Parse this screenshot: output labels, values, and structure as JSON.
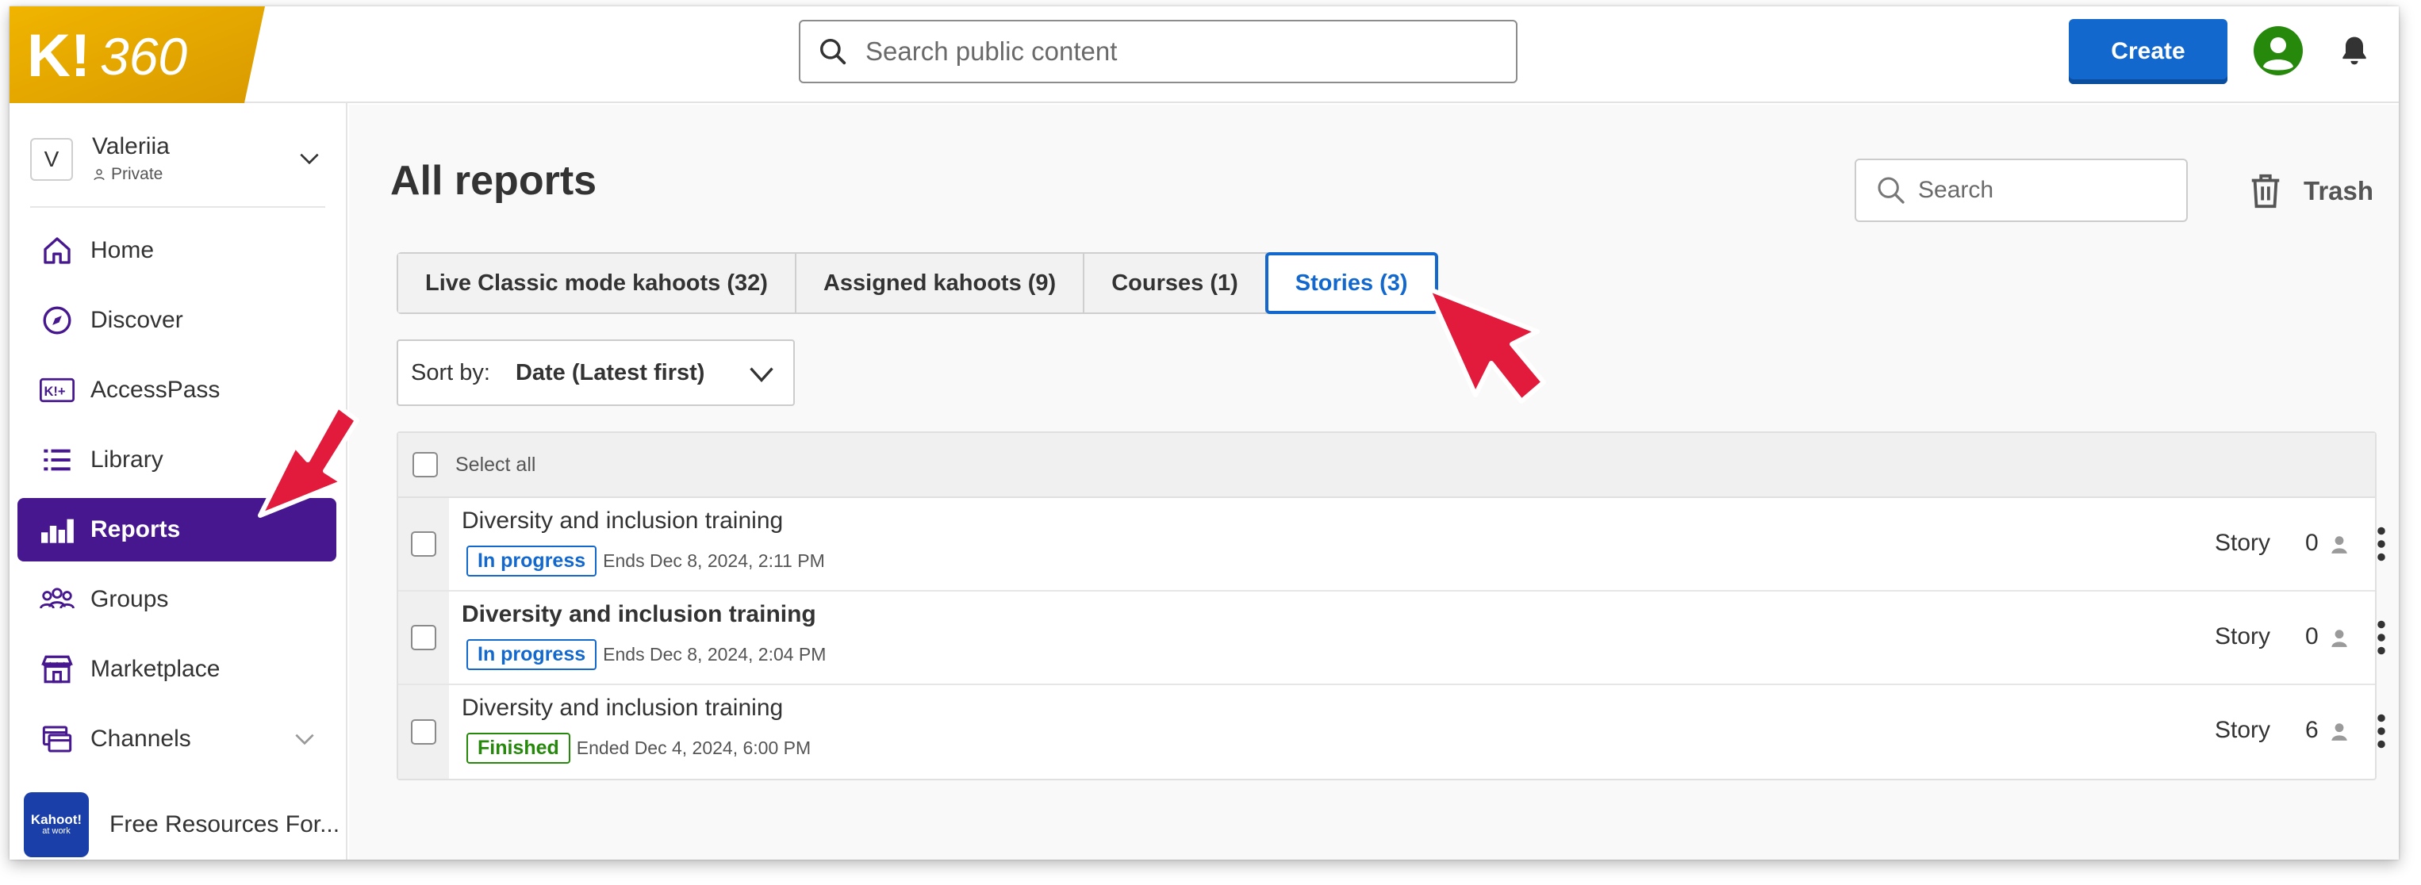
{
  "brand": {
    "logo_text": "K!",
    "logo_sub": "360",
    "gold": "#e5a800"
  },
  "topbar": {
    "search_placeholder": "Search public content",
    "create_label": "Create"
  },
  "user": {
    "initial": "V",
    "name": "Valeriia",
    "visibility": "Private"
  },
  "sidebar": {
    "items": [
      {
        "label": "Home",
        "icon": "home-icon"
      },
      {
        "label": "Discover",
        "icon": "compass-icon"
      },
      {
        "label": "AccessPass",
        "icon": "accesspass-icon"
      },
      {
        "label": "Library",
        "icon": "list-icon"
      },
      {
        "label": "Reports",
        "icon": "bar-chart-icon",
        "active": true
      },
      {
        "label": "Groups",
        "icon": "groups-icon"
      },
      {
        "label": "Marketplace",
        "icon": "store-icon"
      },
      {
        "label": "Channels",
        "icon": "channels-icon"
      }
    ],
    "channel": {
      "logo_line1": "Kahoot!",
      "logo_line2": "at work",
      "name": "Free Resources For..."
    }
  },
  "main": {
    "title": "All reports",
    "search_placeholder": "Search",
    "trash_label": "Trash",
    "tabs": [
      {
        "label": "Live Classic mode kahoots (32)"
      },
      {
        "label": "Assigned kahoots (9)"
      },
      {
        "label": "Courses (1)"
      },
      {
        "label": "Stories (3)",
        "active": true
      }
    ],
    "sort": {
      "label": "Sort by:",
      "value": "Date (Latest first)"
    },
    "select_all_label": "Select all",
    "rows": [
      {
        "title": "Diversity and inclusion training",
        "status": "In progress",
        "date": "Ends Dec 8, 2024, 2:11 PM",
        "type": "Story",
        "players": "0"
      },
      {
        "title": "Diversity and inclusion training",
        "status": "In progress",
        "date": "Ends Dec 8, 2024, 2:04 PM",
        "type": "Story",
        "players": "0"
      },
      {
        "title": "Diversity and inclusion training",
        "status": "Finished",
        "date": "Ended Dec 4, 2024, 6:00 PM",
        "type": "Story",
        "players": "6"
      }
    ]
  },
  "colors": {
    "primary_blue": "#1368ce",
    "purple": "#46178f",
    "green": "#26890c",
    "annotation_red": "#e21b3c"
  }
}
